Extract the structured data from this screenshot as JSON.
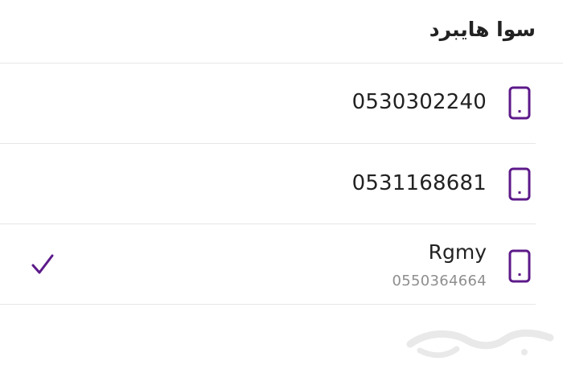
{
  "header": {
    "title": "سوا هايبرد"
  },
  "lines": [
    {
      "number": "0530302240",
      "icon": "phone-icon",
      "selected": false
    },
    {
      "number": "0531168681",
      "icon": "phone-icon",
      "selected": false
    },
    {
      "name": "Rgmy",
      "number": "0550364664",
      "icon": "phone-icon",
      "selected": true
    }
  ],
  "colors": {
    "accent": "#5c1a8a",
    "divider": "#e6e6e6",
    "secondary_text": "#8e8e8e"
  },
  "watermark": {
    "text": "حراج"
  }
}
